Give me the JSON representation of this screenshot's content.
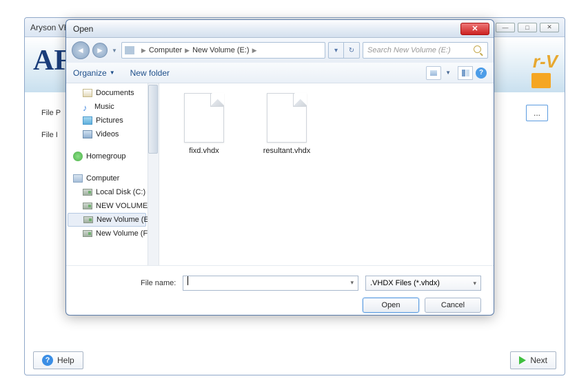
{
  "parentWindow": {
    "title": "Aryson VH",
    "banner": {
      "logo": "AF",
      "rightText": "r-V"
    },
    "labels": {
      "filePath": "File P",
      "fileInfo": "File I"
    },
    "buttons": {
      "browse": "...",
      "help": "Help",
      "next": "Next"
    }
  },
  "dialog": {
    "title": "Open",
    "breadcrumb": {
      "seg1": "Computer",
      "seg2": "New Volume (E:)"
    },
    "search": {
      "placeholder": "Search New Volume (E:)"
    },
    "toolbar": {
      "organize": "Organize",
      "newFolder": "New folder"
    },
    "tree": {
      "documents": "Documents",
      "music": "Music",
      "pictures": "Pictures",
      "videos": "Videos",
      "homegroup": "Homegroup",
      "computer": "Computer",
      "localDisk": "Local Disk (C:)",
      "newVolD": "NEW VOLUME (D",
      "newVolE": "New Volume (E:)",
      "newVolF": "New Volume (F:)"
    },
    "files": [
      {
        "name": "fixd.vhdx"
      },
      {
        "name": "resultant.vhdx"
      }
    ],
    "fileName": {
      "label": "File name:",
      "value": ""
    },
    "filter": ".VHDX Files (*.vhdx)",
    "buttons": {
      "open": "Open",
      "cancel": "Cancel"
    }
  }
}
